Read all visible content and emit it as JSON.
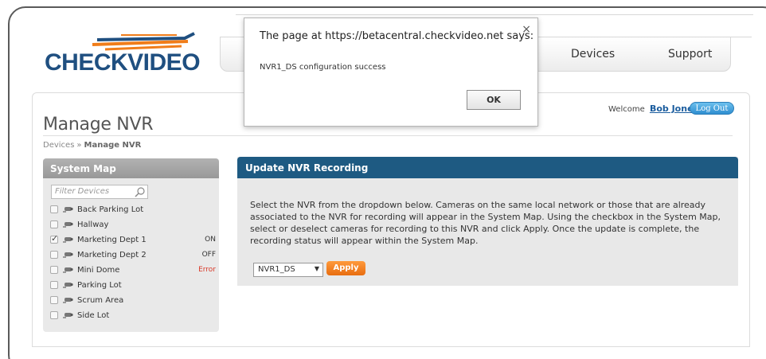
{
  "brand": {
    "logo_check": "CHECK",
    "logo_video": "VIDEO"
  },
  "nav": {
    "items": [
      "Devices",
      "Support"
    ]
  },
  "header": {
    "welcome": "Welcome",
    "user": "Bob Jones",
    "logout": "Log Out"
  },
  "page": {
    "title": "Manage NVR",
    "breadcrumb": {
      "parent": "Devices",
      "separator": "»",
      "current": "Manage NVR"
    }
  },
  "system_map": {
    "title": "System Map",
    "filter_placeholder": "Filter Devices",
    "devices": [
      {
        "name": "Back Parking Lot",
        "checked": false,
        "status": ""
      },
      {
        "name": "Hallway",
        "checked": false,
        "status": ""
      },
      {
        "name": "Marketing Dept 1",
        "checked": true,
        "status": "ON"
      },
      {
        "name": "Marketing Dept 2",
        "checked": false,
        "status": "OFF"
      },
      {
        "name": "Mini Dome",
        "checked": false,
        "status": "Error"
      },
      {
        "name": "Parking Lot",
        "checked": false,
        "status": ""
      },
      {
        "name": "Scrum Area",
        "checked": false,
        "status": ""
      },
      {
        "name": "Side Lot",
        "checked": false,
        "status": ""
      }
    ]
  },
  "nvr_panel": {
    "title": "Update NVR Recording",
    "description": "Select the NVR from the dropdown below. Cameras on the same local network or those that are already associated to the NVR for recording will appear in the System Map. Using the checkbox in the System Map, select or deselect cameras for recording to this NVR and click Apply. Once the update is complete, the recording status will appear within the System Map.",
    "selected_nvr": "NVR1_DS",
    "apply_label": "Apply"
  },
  "dialog": {
    "title": "The page at https://betacentral.checkvideo.net says:",
    "message": "NVR1_DS configuration success",
    "ok_label": "OK",
    "close_glyph": "×"
  },
  "colors": {
    "brand_blue": "#1f4f80",
    "panel_header": "#1e5a82",
    "apply_orange": "#f0801e",
    "error_red": "#d93a2a",
    "link_blue": "#1a5c9e"
  }
}
